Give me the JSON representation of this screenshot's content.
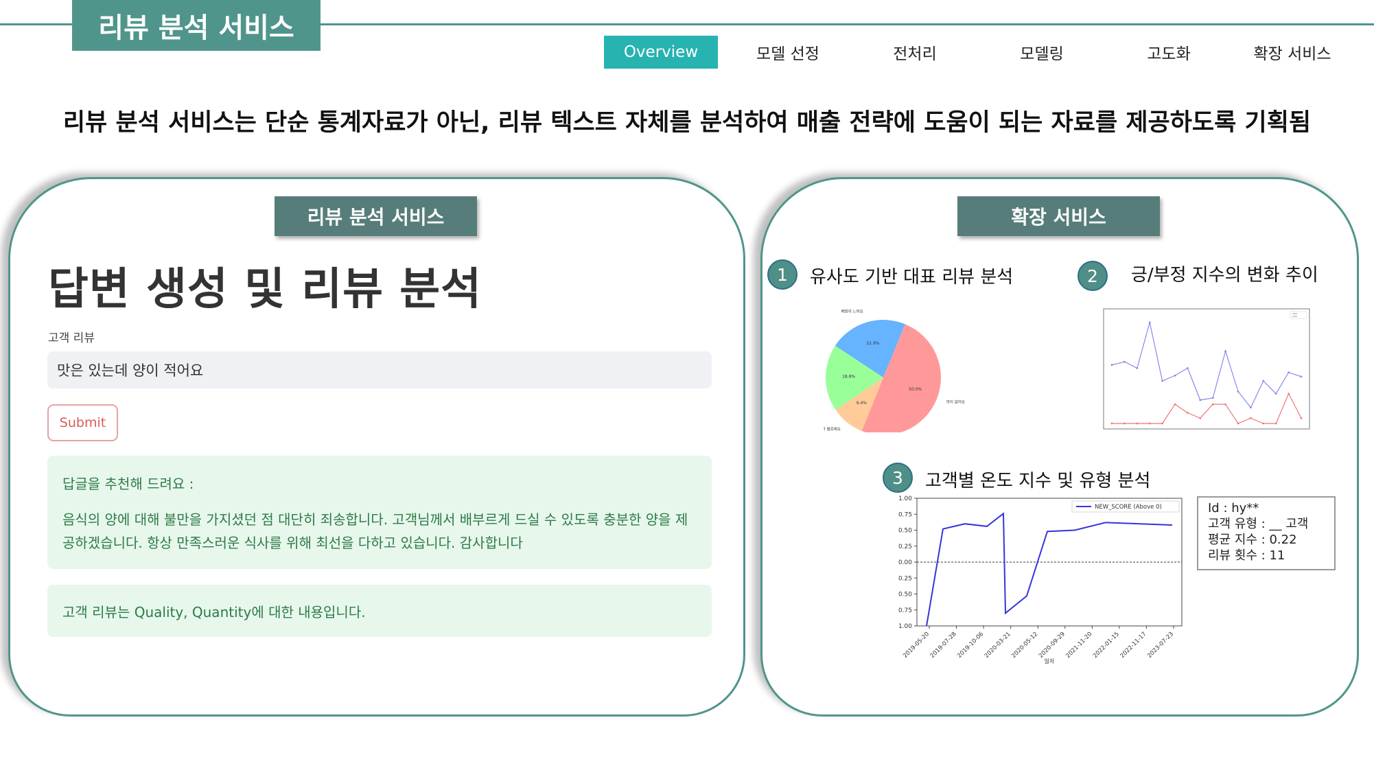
{
  "header": {
    "title": "리뷰 분석 서비스",
    "nav": [
      {
        "label": "Overview",
        "active": true
      },
      {
        "label": "모델 선정",
        "active": false
      },
      {
        "label": "전처리",
        "active": false
      },
      {
        "label": "모델링",
        "active": false
      },
      {
        "label": "고도화",
        "active": false
      },
      {
        "label": "확장 서비스",
        "active": false
      }
    ]
  },
  "headline": "리뷰 분석 서비스는 단순 통계자료가 아닌, 리뷰 텍스트 자체를 분석하여 매출 전략에 도움이 되는 자료를 제공하도록 기획됨",
  "left_panel": {
    "label": "리뷰 분석 서비스",
    "title": "답변 생성 및 리뷰 분석",
    "review_label": "고객 리뷰",
    "review_value": "맛은 있는데 양이 적어요",
    "submit_label": "Submit",
    "reply_heading": "답글을 추천해 드려요 :",
    "reply_text": "음식의 양에 대해 불만을 가지셨던 점 대단히 죄송합니다. 고객님께서 배부르게 드실 수 있도록 충분한 양을 제공하겠습니다. 항상 만족스러운 식사를 위해 최선을 다하고 있습니다. 감사합니다",
    "summary_text": "고객 리뷰는 Quality, Quantity에 대한 내용입니다."
  },
  "right_panel": {
    "label": "확장 서비스",
    "features": [
      {
        "num": "1",
        "label": "유사도 기반 대표 리뷰 분석"
      },
      {
        "num": "2",
        "label": "긍/부정 지수의 변화 추이"
      },
      {
        "num": "3",
        "label": "고객별 온도 지수 및 유형 분석"
      }
    ],
    "info": {
      "id": "Id : hy**",
      "type": "고객 유형 : __ 고객",
      "avg": "평균 지수 : 0.22",
      "count": "리뷰 횟수 : 11"
    }
  },
  "chart_data": [
    {
      "type": "pie",
      "labels": [
        "맛이 없어요",
        "배달이 느려요",
        "양이 적어요",
        "서비스가 별로예요"
      ],
      "values": [
        50.0,
        21.9,
        18.8,
        9.4
      ],
      "value_labels": [
        "50.0%",
        "21.9%",
        "18.8%",
        "9.4%"
      ],
      "colors": [
        "#ff9999",
        "#66b3ff",
        "#99ff99",
        "#ffcc99"
      ]
    },
    {
      "type": "line",
      "x": [
        1,
        2,
        3,
        4,
        5,
        6,
        7,
        8,
        9,
        10,
        11,
        12,
        13,
        14,
        15,
        16,
        17,
        18,
        19
      ],
      "series": [
        {
          "values": [
            0.55,
            0.58,
            0.52,
            0.95,
            0.4,
            0.45,
            0.52,
            0.22,
            0.24,
            0.68,
            0.3,
            0.15,
            0.4,
            0.28,
            0.48,
            0.44
          ],
          "color": "#8888ee"
        },
        {
          "values": [
            0.0,
            0.0,
            0.0,
            0.0,
            0.0,
            0.18,
            0.1,
            0.05,
            0.18,
            0.18,
            0.0,
            0.05,
            0.0,
            0.0,
            0.28,
            0.05
          ],
          "color": "#ee7777"
        }
      ],
      "ylim": [
        0,
        1
      ]
    },
    {
      "type": "line",
      "legend": "NEW_SCORE (Above 0)",
      "categories": [
        "2019-05-20",
        "2019-07-28",
        "2019-10-06",
        "2020-03-21",
        "2020-05-12",
        "2020-09-29",
        "2021-11-20",
        "2022-01-15",
        "2022-11-17",
        "2023-07-23"
      ],
      "values": [
        -1.0,
        0.52,
        0.6,
        0.56,
        0.76,
        -0.8,
        -0.53,
        0.48,
        0.5,
        0.62,
        0.58
      ],
      "y_ticks": [
        "1.00",
        "0.75",
        "0.50",
        "0.25",
        "0.00",
        "0.25",
        "0.50",
        "0.75",
        "1.00"
      ],
      "xlabel": "일자",
      "ylim": [
        -1,
        1
      ],
      "reference_line": 0
    }
  ]
}
